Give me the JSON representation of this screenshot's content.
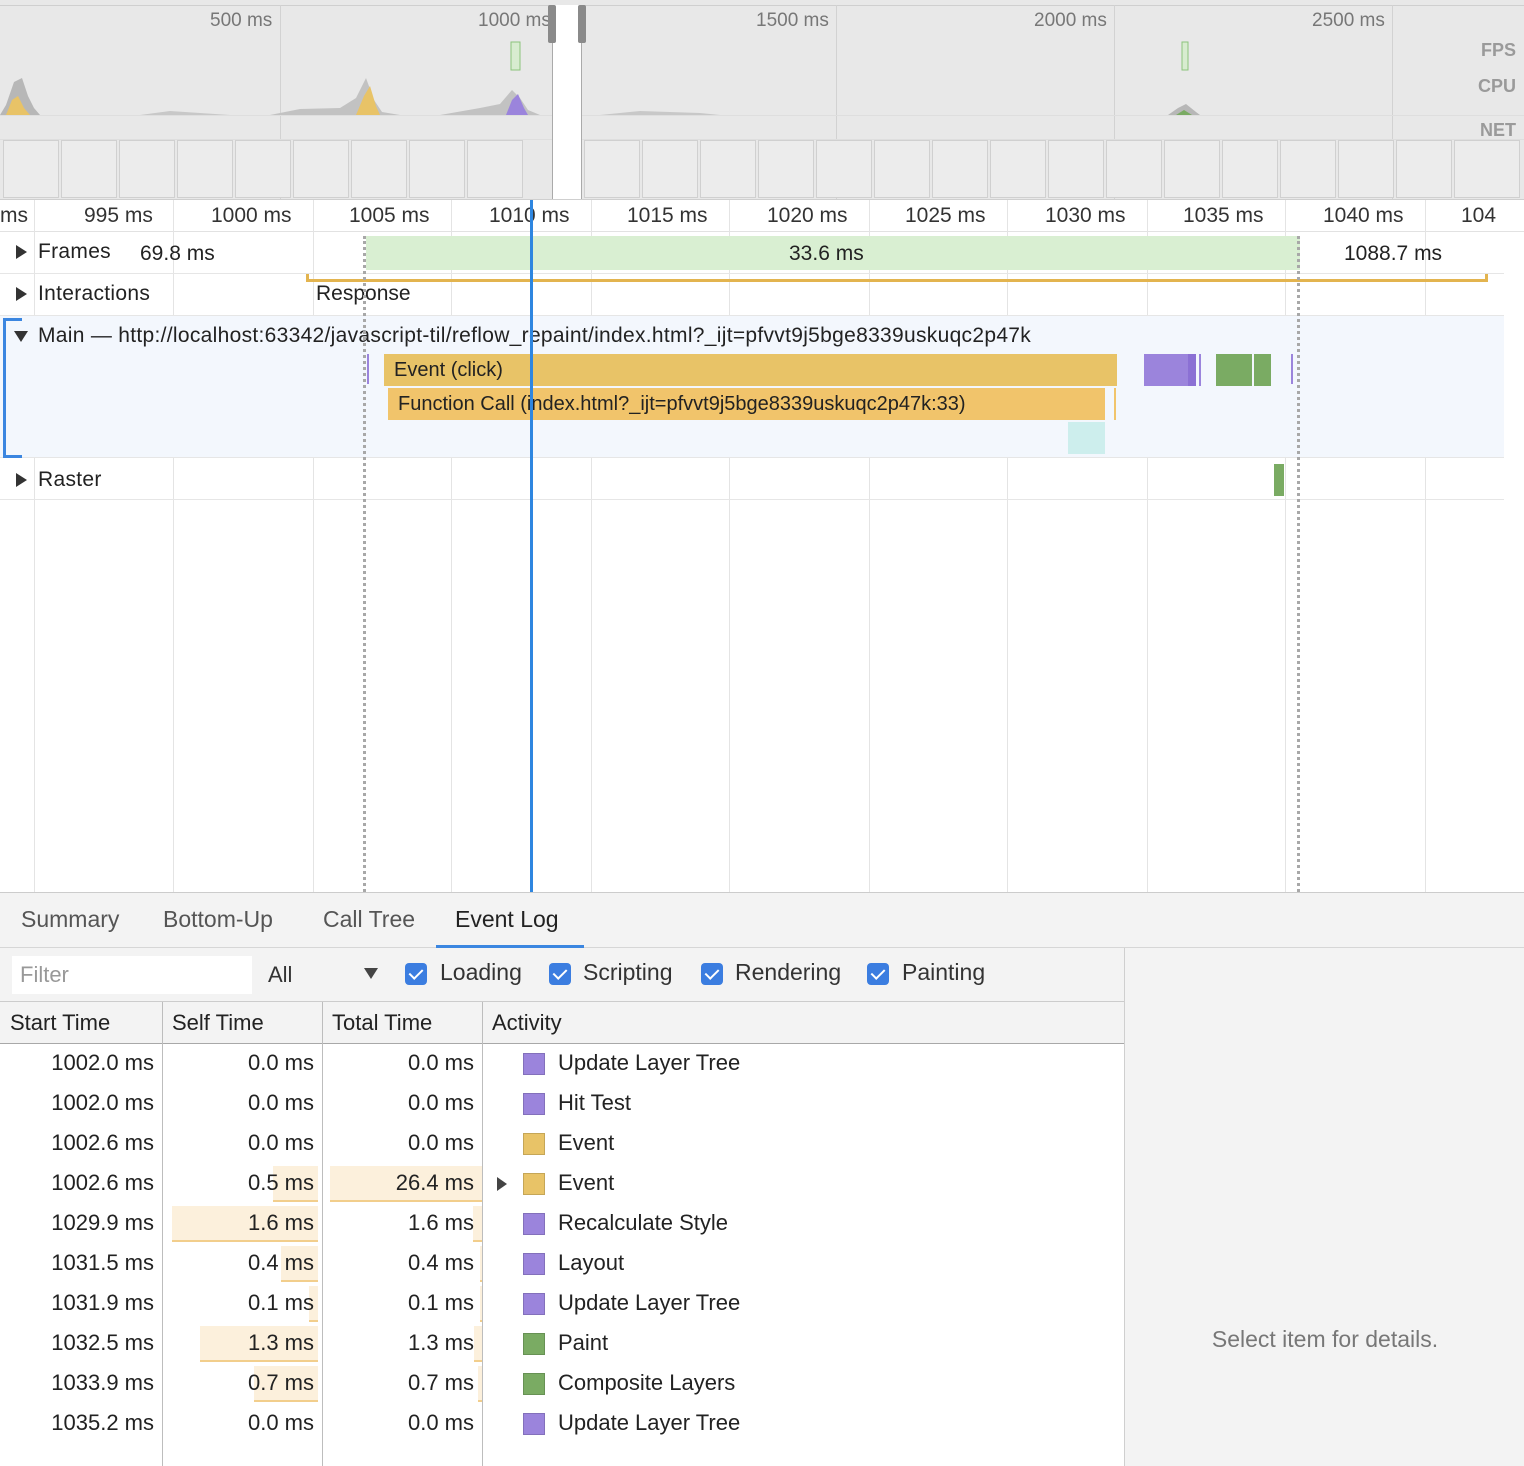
{
  "overview": {
    "ticks": [
      "500 ms",
      "1000 ms",
      "1500 ms",
      "2000 ms",
      "2500 ms"
    ],
    "labels": {
      "fps": "FPS",
      "cpu": "CPU",
      "net": "NET"
    }
  },
  "ruler": {
    "ticks": [
      "ms",
      "995 ms",
      "1000 ms",
      "1005 ms",
      "1010 ms",
      "1015 ms",
      "1020 ms",
      "1025 ms",
      "1030 ms",
      "1035 ms",
      "1040 ms",
      "104"
    ]
  },
  "tracks": {
    "frames": {
      "title": "Frames",
      "frame_before": "69.8 ms",
      "frame_selected": "33.6 ms",
      "frame_after": "1088.7 ms"
    },
    "interactions": {
      "title": "Interactions",
      "response": "Response"
    },
    "main": {
      "title": "Main — http://localhost:63342/javascript-til/reflow_repaint/index.html?_ijt=pfvvt9j5bge8339uskuqc2p47k",
      "event_bar": "Event (click)",
      "function_bar": "Function Call (index.html?_ijt=pfvvt9j5bge8339uskuqc2p47k:33)"
    },
    "raster": {
      "title": "Raster"
    }
  },
  "tabs": [
    "Summary",
    "Bottom-Up",
    "Call Tree",
    "Event Log"
  ],
  "active_tab": "Event Log",
  "filter": {
    "placeholder": "Filter",
    "select_value": "All",
    "checkboxes": [
      {
        "label": "Loading",
        "checked": true
      },
      {
        "label": "Scripting",
        "checked": true
      },
      {
        "label": "Rendering",
        "checked": true
      },
      {
        "label": "Painting",
        "checked": true
      }
    ]
  },
  "table": {
    "headers": {
      "start": "Start Time",
      "self": "Self Time",
      "total": "Total Time",
      "activity": "Activity"
    },
    "rows": [
      {
        "start": "1002.0 ms",
        "self": "0.0 ms",
        "total": "0.0 ms",
        "activity": "Update Layer Tree",
        "category": "rendering",
        "self_frac": 0.0,
        "total_frac": 0.0,
        "expandable": false
      },
      {
        "start": "1002.0 ms",
        "self": "0.0 ms",
        "total": "0.0 ms",
        "activity": "Hit Test",
        "category": "rendering",
        "self_frac": 0.0,
        "total_frac": 0.0,
        "expandable": false
      },
      {
        "start": "1002.6 ms",
        "self": "0.0 ms",
        "total": "0.0 ms",
        "activity": "Event",
        "category": "scripting",
        "self_frac": 0.0,
        "total_frac": 0.0,
        "expandable": false
      },
      {
        "start": "1002.6 ms",
        "self": "0.5 ms",
        "total": "26.4 ms",
        "activity": "Event",
        "category": "scripting",
        "self_frac": 0.31,
        "total_frac": 1.0,
        "expandable": true
      },
      {
        "start": "1029.9 ms",
        "self": "1.6 ms",
        "total": "1.6 ms",
        "activity": "Recalculate Style",
        "category": "rendering",
        "self_frac": 1.0,
        "total_frac": 0.06,
        "expandable": false
      },
      {
        "start": "1031.5 ms",
        "self": "0.4 ms",
        "total": "0.4 ms",
        "activity": "Layout",
        "category": "rendering",
        "self_frac": 0.25,
        "total_frac": 0.015,
        "expandable": false
      },
      {
        "start": "1031.9 ms",
        "self": "0.1 ms",
        "total": "0.1 ms",
        "activity": "Update Layer Tree",
        "category": "rendering",
        "self_frac": 0.06,
        "total_frac": 0.004,
        "expandable": false
      },
      {
        "start": "1032.5 ms",
        "self": "1.3 ms",
        "total": "1.3 ms",
        "activity": "Paint",
        "category": "painting",
        "self_frac": 0.81,
        "total_frac": 0.05,
        "expandable": false
      },
      {
        "start": "1033.9 ms",
        "self": "0.7 ms",
        "total": "0.7 ms",
        "activity": "Composite Layers",
        "category": "painting",
        "self_frac": 0.44,
        "total_frac": 0.027,
        "expandable": false
      },
      {
        "start": "1035.2 ms",
        "self": "0.0 ms",
        "total": "0.0 ms",
        "activity": "Update Layer Tree",
        "category": "rendering",
        "self_frac": 0.0,
        "total_frac": 0.0,
        "expandable": false
      }
    ]
  },
  "details": {
    "placeholder": "Select item for details."
  },
  "colors": {
    "scripting": "#e8c367",
    "rendering": "#9b84dc",
    "painting": "#7aab63",
    "frame": "#d9efd2",
    "selection": "#3b86e0",
    "cyan_block": "#cdeeed"
  }
}
